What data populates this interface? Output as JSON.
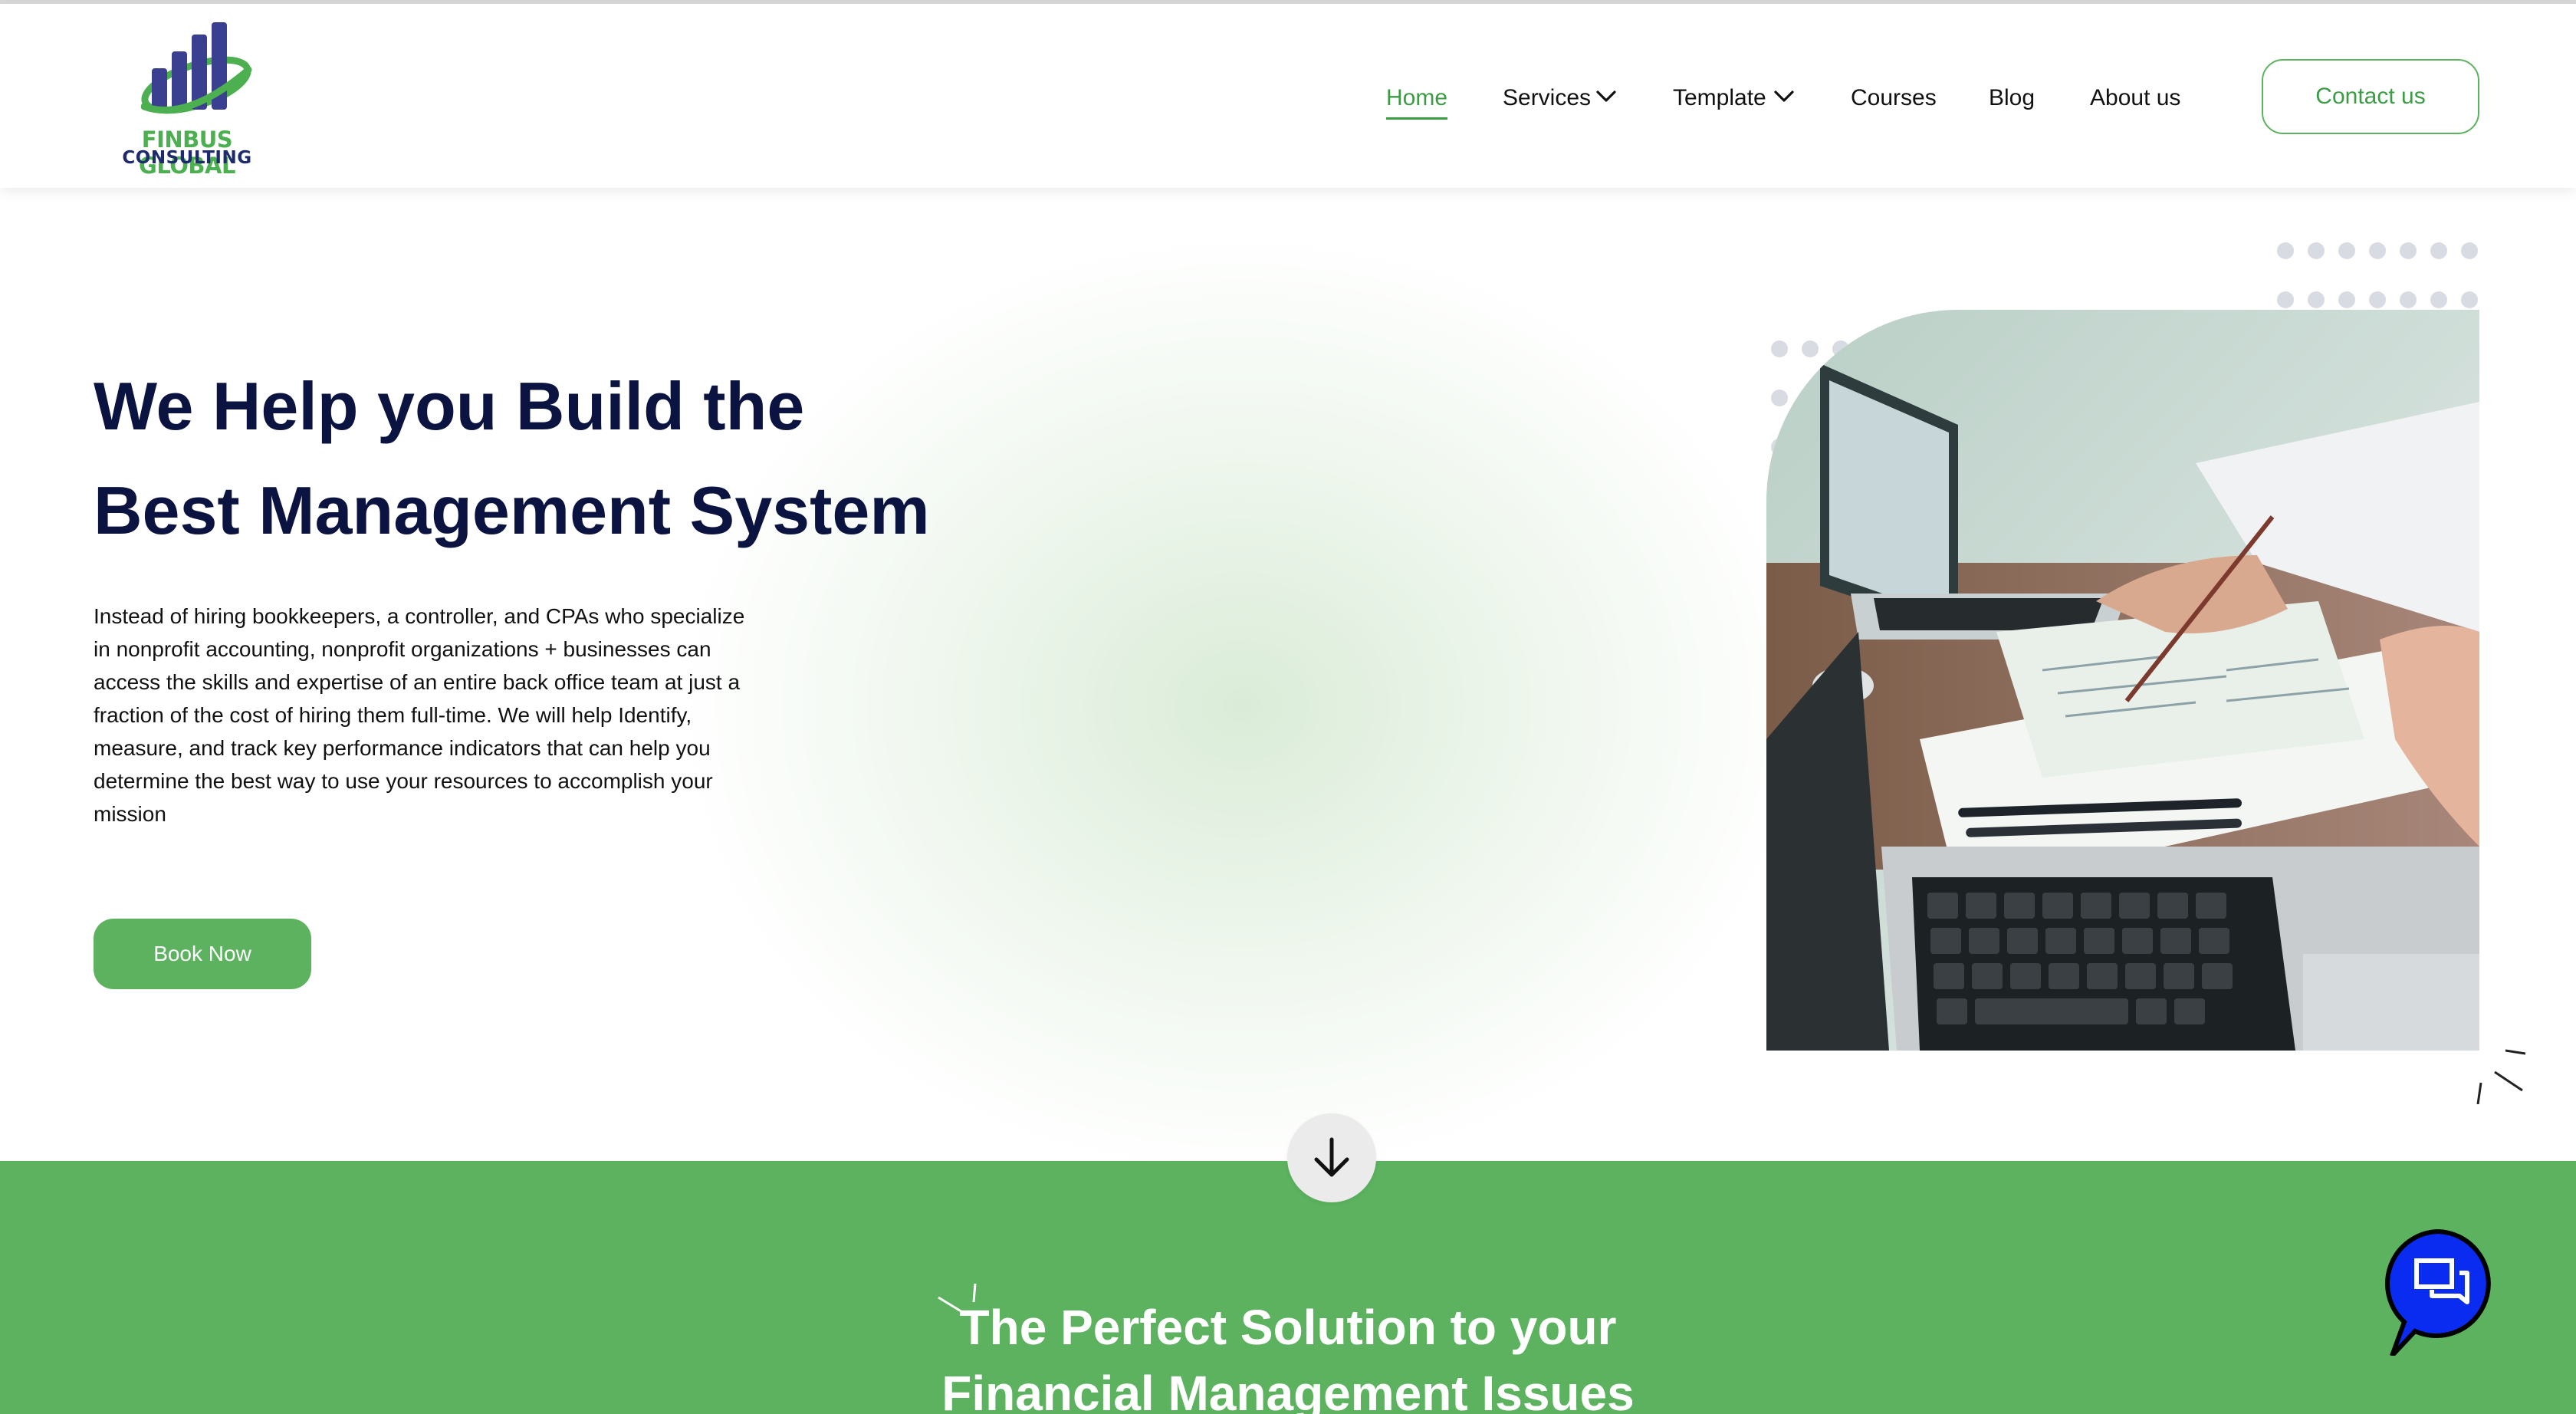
{
  "brand": {
    "name_line1": "FINBUS GLOBAL",
    "name_line2": "CONSULTING"
  },
  "nav": {
    "items": [
      {
        "label": "Home",
        "active": true
      },
      {
        "label": "Services",
        "dropdown": true
      },
      {
        "label": "Template",
        "dropdown": true
      },
      {
        "label": "Courses"
      },
      {
        "label": "Blog"
      },
      {
        "label": "About us"
      }
    ],
    "contact_label": "Contact us"
  },
  "hero": {
    "title_line1": "We Help you Build the",
    "title_line2": "Best Management System",
    "paragraph": "Instead of hiring bookkeepers, a controller, and CPAs who specialize in nonprofit accounting, nonprofit organizations + businesses can access the skills and expertise of an entire back office team at just a fraction of the cost of hiring them full-time. We will help Identify, measure, and track key performance indicators that can help you determine the best way to use your resources to accomplish your mission",
    "cta_label": "Book Now"
  },
  "section": {
    "title_line1": "The Perfect Solution to your",
    "title_line2": "Financial Management Issues"
  },
  "icons": {
    "scroll": "arrow-down-icon",
    "chat": "chat-icon",
    "dropdown": "chevron-down-icon"
  },
  "colors": {
    "accent": "#5cb25f",
    "accent_text": "#3d9b45",
    "heading": "#0b1340",
    "chat": "#0a2cf0",
    "logo_navy": "#1e2a6e"
  }
}
